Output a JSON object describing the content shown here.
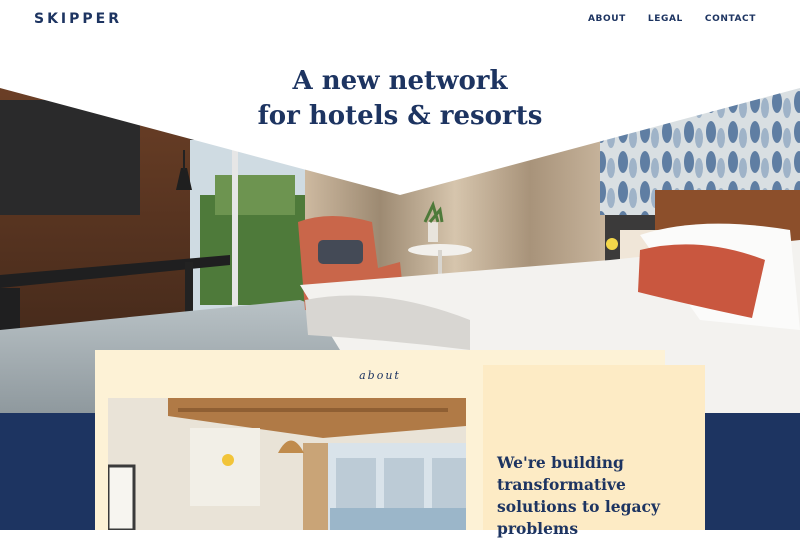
{
  "brand": {
    "name": "SKIPPER"
  },
  "nav": {
    "items": [
      {
        "label": "ABOUT"
      },
      {
        "label": "LEGAL"
      },
      {
        "label": "CONTACT"
      }
    ]
  },
  "hero": {
    "headline_line1": "A new network",
    "headline_line2": "for hotels & resorts"
  },
  "about": {
    "label": "about",
    "tagline": "We're building transformative solutions to legacy problems"
  },
  "colors": {
    "navy": "#1d3461",
    "cream": "#fdf2d6",
    "cream_dark": "#fdebc5",
    "background": "#ffffff"
  }
}
